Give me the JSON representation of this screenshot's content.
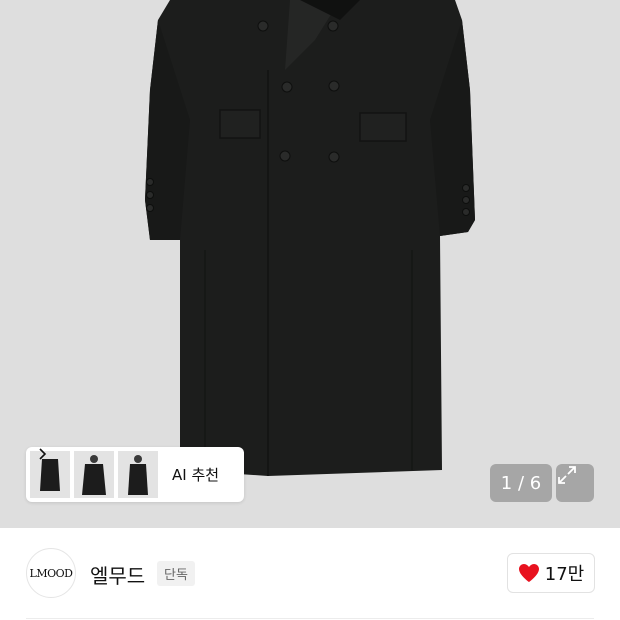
{
  "gallery": {
    "ai_recommend_label": "AI 추천",
    "pager_text": "1 / 6",
    "thumbnails": [
      "coat-thumb-1",
      "coat-thumb-2",
      "coat-thumb-3"
    ]
  },
  "brand": {
    "logo_text": "LMOOD",
    "name": "엘무드",
    "badge": "단독",
    "like_count": "17만"
  },
  "colors": {
    "like_heart": "#e8121f",
    "coat": "#1c1d1c",
    "background": "#dedede"
  },
  "icons": [
    "chevron-right-icon",
    "expand-icon",
    "heart-icon"
  ]
}
